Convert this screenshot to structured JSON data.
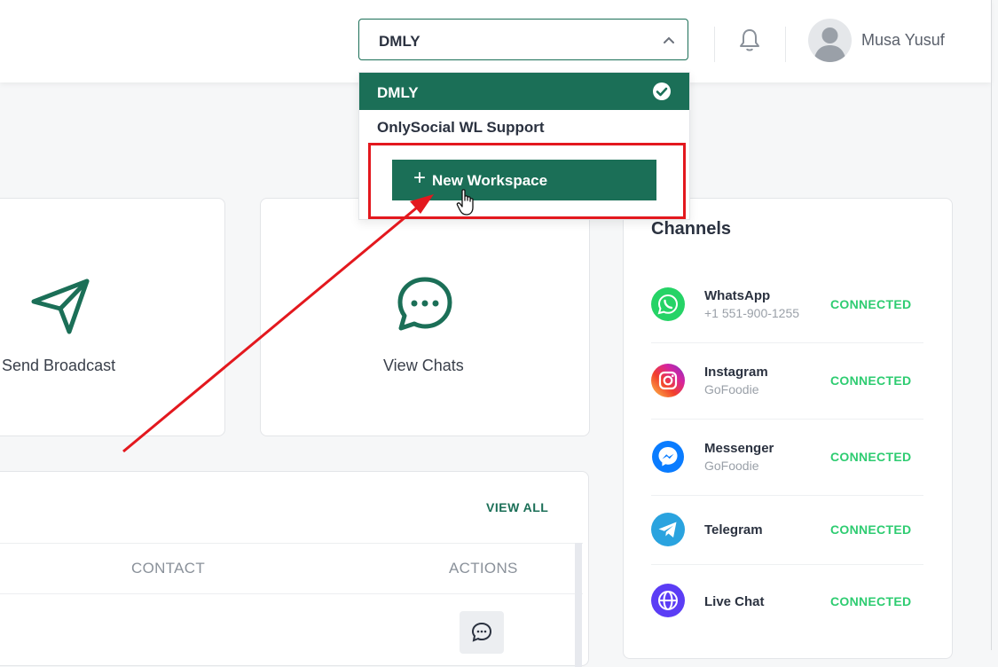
{
  "header": {
    "workspace_selected": "DMLY",
    "user_name": "Musa Yusuf"
  },
  "workspace_dropdown": {
    "items": [
      {
        "label": "DMLY",
        "active": true
      },
      {
        "label": "OnlySocial WL Support",
        "active": false
      }
    ],
    "new_workspace_label": "New Workspace"
  },
  "quick_actions": [
    {
      "label": "Send Broadcast",
      "icon": "send-icon"
    },
    {
      "label": "View Chats",
      "icon": "chat-bubble-icon"
    }
  ],
  "channels": {
    "title": "Channels",
    "items": [
      {
        "name": "WhatsApp",
        "sub": "+1 551-900-1255",
        "status": "CONNECTED",
        "icon": "whatsapp-icon",
        "color": "#25d366"
      },
      {
        "name": "Instagram",
        "sub": "GoFoodie",
        "status": "CONNECTED",
        "icon": "instagram-icon",
        "color": "#d6249f"
      },
      {
        "name": "Messenger",
        "sub": "GoFoodie",
        "status": "CONNECTED",
        "icon": "messenger-icon",
        "color": "#0a7cff"
      },
      {
        "name": "Telegram",
        "sub": "",
        "status": "CONNECTED",
        "icon": "telegram-icon",
        "color": "#2aa3df"
      },
      {
        "name": "Live Chat",
        "sub": "",
        "status": "CONNECTED",
        "icon": "globe-icon",
        "color": "#5b3df5"
      }
    ]
  },
  "table": {
    "view_all": "VIEW ALL",
    "columns": [
      "CONTACT",
      "ACTIONS"
    ]
  },
  "colors": {
    "brand": "#1b6f57",
    "connected": "#2ecc71",
    "annotation": "#e3181e"
  }
}
